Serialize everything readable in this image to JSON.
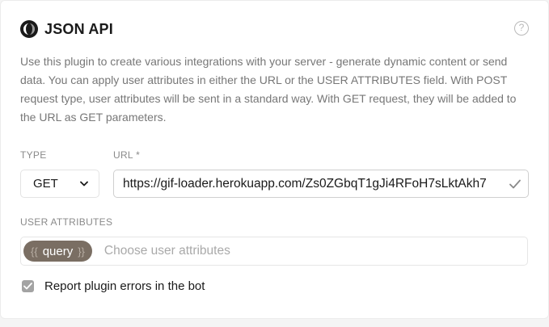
{
  "header": {
    "title": "JSON API",
    "logo_icon": "json-api-logo-icon",
    "help_icon": "question-mark-icon",
    "help_symbol": "?"
  },
  "description": "Use this plugin to create various integrations with your server - generate dynamic content or send data. You can apply user attributes in either the URL or the USER ATTRIBUTES field. With POST request type, user attributes will be sent in a standard way. With GET request, they will be added to the URL as GET parameters.",
  "type_field": {
    "label": "TYPE",
    "value": "GET",
    "icon": "chevron-down-icon"
  },
  "url_field": {
    "label": "URL *",
    "value": "https://gif-loader.herokuapp.com/Zs0ZGbqT1gJi4RFoH7sLktAkh7",
    "status_icon": "checkmark-icon"
  },
  "user_attributes": {
    "label": "USER ATTRIBUTES",
    "chip": {
      "open_brace": "{{",
      "text": "query",
      "close_brace": "}}"
    },
    "placeholder": "Choose user attributes"
  },
  "report_errors": {
    "label": "Report plugin errors in the bot",
    "checked": true
  },
  "colors": {
    "chip_bg": "#7a6e63",
    "checkbox_bg": "#a3a3a3",
    "text_muted": "#777777"
  }
}
